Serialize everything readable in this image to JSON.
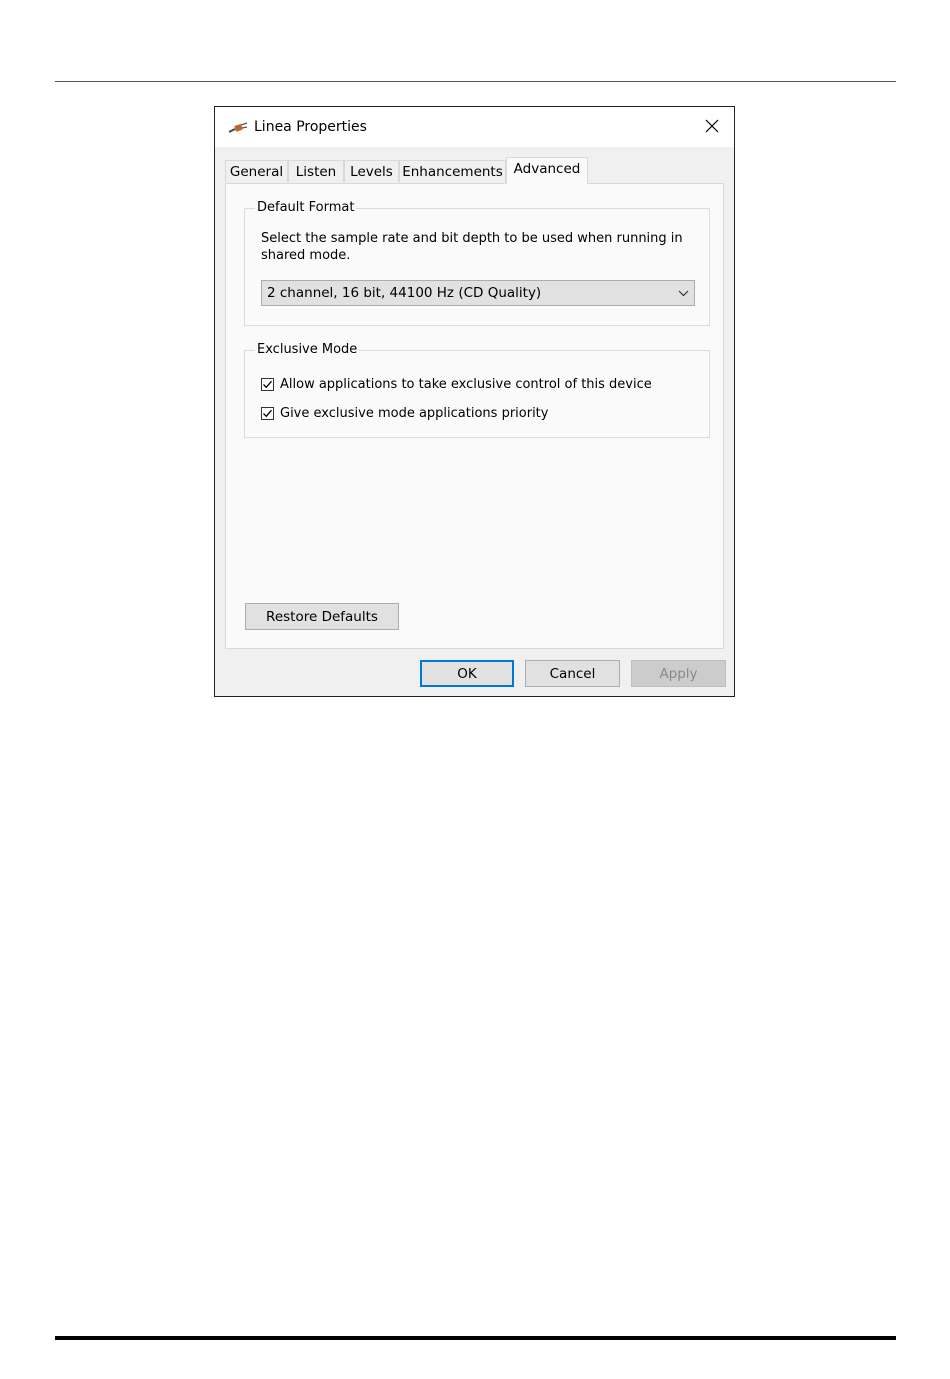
{
  "window": {
    "title": "Linea Properties",
    "icon": "audio-plug-icon",
    "close_icon": "close-icon"
  },
  "tabs": [
    {
      "label": "General",
      "active": false
    },
    {
      "label": "Listen",
      "active": false
    },
    {
      "label": "Levels",
      "active": false
    },
    {
      "label": "Enhancements",
      "active": false
    },
    {
      "label": "Advanced",
      "active": true
    }
  ],
  "default_format": {
    "group_label": "Default Format",
    "description": "Select the sample rate and bit depth to be used when running in shared mode.",
    "selected_format": "2 channel, 16 bit, 44100 Hz (CD Quality)"
  },
  "exclusive_mode": {
    "group_label": "Exclusive Mode",
    "options": [
      {
        "label": "Allow applications to take exclusive control of this device",
        "checked": true
      },
      {
        "label": "Give exclusive mode applications priority",
        "checked": true
      }
    ]
  },
  "buttons": {
    "restore_defaults": "Restore Defaults",
    "ok": "OK",
    "cancel": "Cancel",
    "apply": "Apply"
  },
  "colors": {
    "accent": "#0078d7",
    "dialog_bg": "#f0f0f0",
    "button_bg": "#e1e1e1"
  }
}
